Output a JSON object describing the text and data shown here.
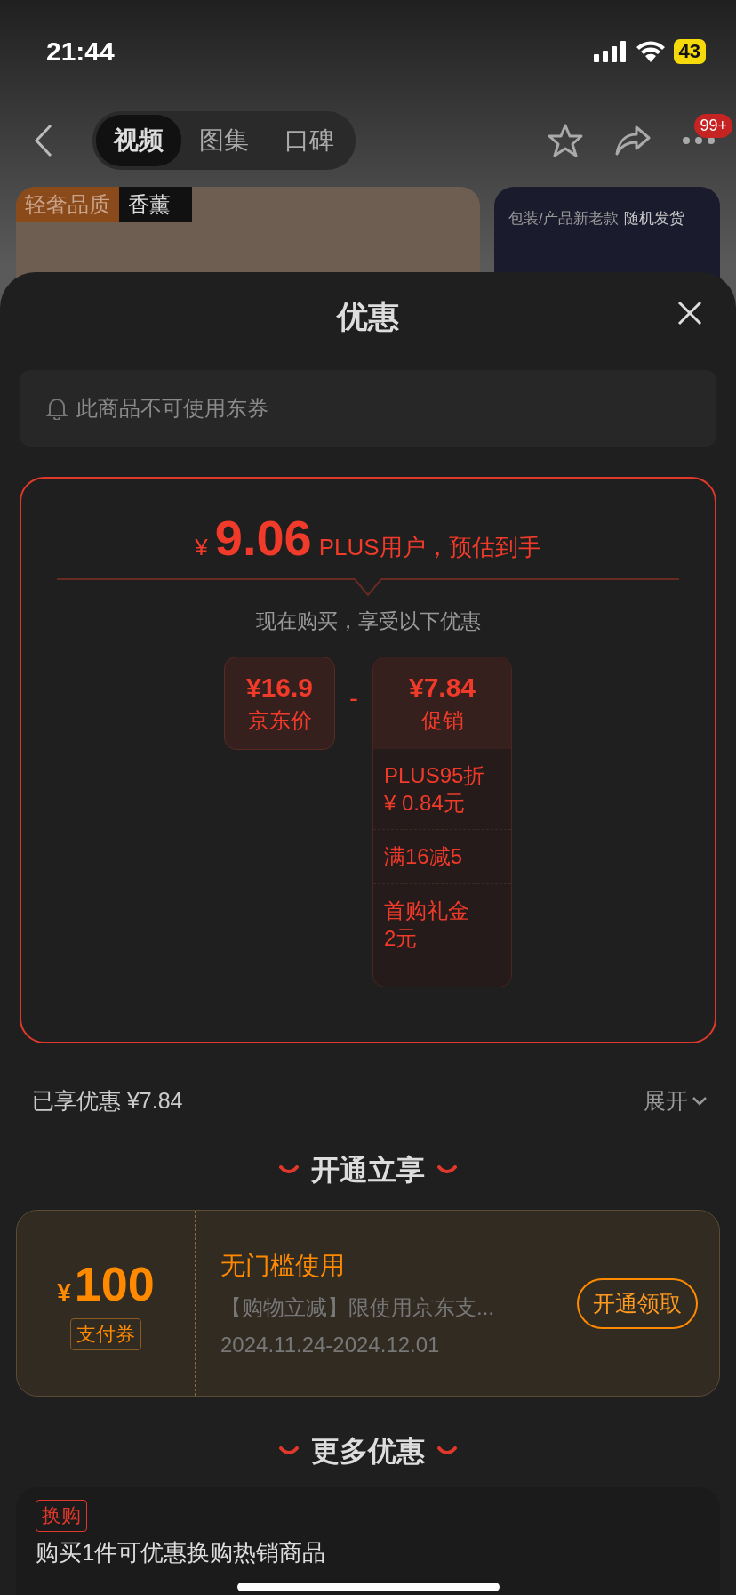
{
  "status_bar": {
    "time": "21:44",
    "battery": "43"
  },
  "nav": {
    "tabs": [
      {
        "label": "视频",
        "selected": true
      },
      {
        "label": "图集",
        "selected": false
      },
      {
        "label": "口碑",
        "selected": false
      }
    ],
    "badge": "99+"
  },
  "background_cards": {
    "tags": [
      "轻奢品质",
      "香薰"
    ],
    "caption": "包装/产品新老款",
    "caption_strong": "随机发货"
  },
  "sheet": {
    "title": "优惠",
    "notice": "此商品不可使用东券",
    "estimate": {
      "currency": "¥",
      "price": "9.06",
      "label": "PLUS用户，预估到手",
      "subtitle": "现在购买，享受以下优惠",
      "base": {
        "amount": "¥16.9",
        "label": "京东价"
      },
      "operator": "-",
      "discount": {
        "amount": "¥7.84",
        "label": "促销",
        "items": [
          {
            "lines": [
              "PLUS95折",
              "¥ 0.84元"
            ]
          },
          {
            "lines": [
              "满16减5"
            ]
          },
          {
            "lines": [
              "首购礼金",
              "2元"
            ]
          }
        ]
      }
    },
    "enjoyed": "已享优惠 ¥7.84",
    "expand": "展开",
    "vip_section": {
      "title": "开通立享",
      "coupon": {
        "currency": "¥",
        "amount": "100",
        "type": "支付券",
        "title": "无门槛使用",
        "desc": "【购物立减】限使用京东支...",
        "dates": "2024.11.24-2024.12.01",
        "button": "开通领取"
      }
    },
    "more_section": {
      "title": "更多优惠",
      "offer": {
        "tag": "换购",
        "text": "购买1件可优惠换购热销商品"
      }
    }
  }
}
